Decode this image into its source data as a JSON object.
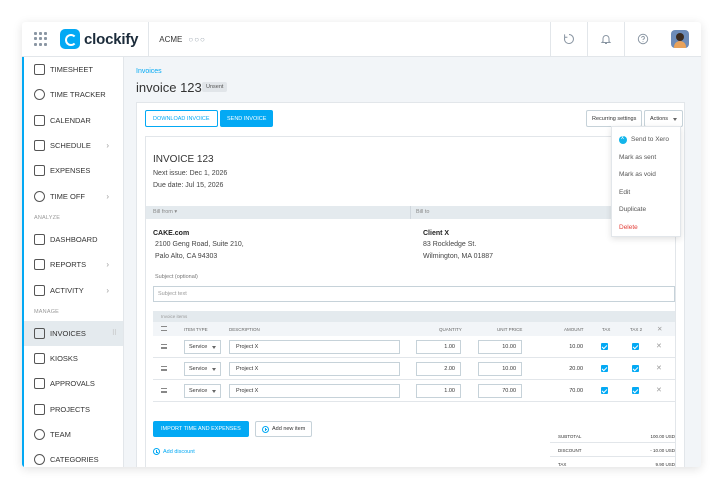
{
  "topbar": {
    "logo_text": "clockify",
    "workspace": "ACME",
    "workspace_dots": "○○○",
    "icons": [
      "help-refresh-icon",
      "bell-icon",
      "help-icon"
    ]
  },
  "sidebar": {
    "items": [
      {
        "label": "TIMESHEET",
        "icon": "timesheet-icon"
      },
      {
        "label": "TIME TRACKER",
        "icon": "clock-icon"
      },
      {
        "label": "CALENDAR",
        "icon": "calendar-icon"
      },
      {
        "label": "SCHEDULE",
        "icon": "schedule-icon",
        "chevron": "›"
      },
      {
        "label": "EXPENSES",
        "icon": "receipt-icon"
      },
      {
        "label": "TIME OFF",
        "icon": "time-off-icon",
        "chevron": "›"
      }
    ],
    "analyze_label": "ANALYZE",
    "analyze_items": [
      {
        "label": "DASHBOARD",
        "icon": "dashboard-icon"
      },
      {
        "label": "REPORTS",
        "icon": "reports-icon",
        "chevron": "›"
      },
      {
        "label": "ACTIVITY",
        "icon": "activity-icon",
        "chevron": "›"
      }
    ],
    "manage_label": "MANAGE",
    "manage_items": [
      {
        "label": "INVOICES",
        "icon": "invoice-icon",
        "active": true,
        "grip": "⠿"
      },
      {
        "label": "KIOSKS",
        "icon": "kiosk-icon"
      },
      {
        "label": "APPROVALS",
        "icon": "approvals-icon"
      },
      {
        "label": "PROJECTS",
        "icon": "projects-icon"
      },
      {
        "label": "TEAM",
        "icon": "team-icon"
      },
      {
        "label": "CATEGORIES",
        "icon": "categories-icon"
      }
    ]
  },
  "page": {
    "breadcrumb": "Invoices",
    "title": "invoice 123",
    "status_badge": "Unsent"
  },
  "toolbar": {
    "download": "DOWNLOAD INVOICE",
    "send": "SEND INVOICE",
    "recurring": "Recurring settings",
    "actions": "Actions"
  },
  "actions_menu": {
    "items": [
      {
        "label": "Send to Xero",
        "icon": "xero-icon"
      },
      {
        "label": "Mark as sent"
      },
      {
        "label": "Mark as void"
      },
      {
        "label": "Edit"
      },
      {
        "label": "Duplicate"
      },
      {
        "label": "Delete",
        "danger": true
      }
    ]
  },
  "invoice": {
    "heading": "INVOICE 123",
    "next_issue": "Next issue: Dec 1, 2026",
    "due_date": "Due date: Jul 15, 2026",
    "bill_from_label": "Bill from ▾",
    "bill_to_label": "Bill to",
    "from": {
      "name": "CAKE.com",
      "line1": "2100 Geng Road, Suite 210,",
      "line2": "Palo Alto, CA 94303"
    },
    "to": {
      "name": "Client X",
      "line1": "83 Rockledge St.",
      "line2": "Wilmington, MA 01887"
    },
    "subject_label": "Subject (optional)",
    "subject_placeholder": "Subject text"
  },
  "items_table": {
    "section_label": "Invoice items",
    "headers": {
      "item_type": "ITEM TYPE",
      "description": "DESCRIPTION",
      "quantity": "QUANTITY",
      "unit_price": "UNIT PRICE",
      "amount": "AMOUNT",
      "tax": "TAX",
      "tax2": "TAX 2",
      "remove": "✕"
    },
    "rows": [
      {
        "type": "Service",
        "description": "Project X",
        "quantity": "1.00",
        "unit_price": "10.00",
        "amount": "10.00",
        "tax": true,
        "tax2": true
      },
      {
        "type": "Service",
        "description": "Project X",
        "quantity": "2.00",
        "unit_price": "10.00",
        "amount": "20.00",
        "tax": true,
        "tax2": true
      },
      {
        "type": "Service",
        "description": "Project X",
        "quantity": "1.00",
        "unit_price": "70.00",
        "amount": "70.00",
        "tax": true,
        "tax2": true
      }
    ],
    "remove_glyph": "✕"
  },
  "footer_actions": {
    "import": "IMPORT TIME AND EXPENSES",
    "add_new": "Add new item",
    "add_discount": "Add discount"
  },
  "totals": [
    {
      "label": "SUBTOTAL",
      "value": "100.00 USD"
    },
    {
      "label": "DISCOUNT",
      "value": "- 10.00 USD"
    },
    {
      "label": "TAX",
      "value": "9.90 USD"
    }
  ],
  "colors": {
    "accent": "#03a9f4",
    "danger": "#e4413b",
    "sidebar_active": "#e4eaee"
  }
}
